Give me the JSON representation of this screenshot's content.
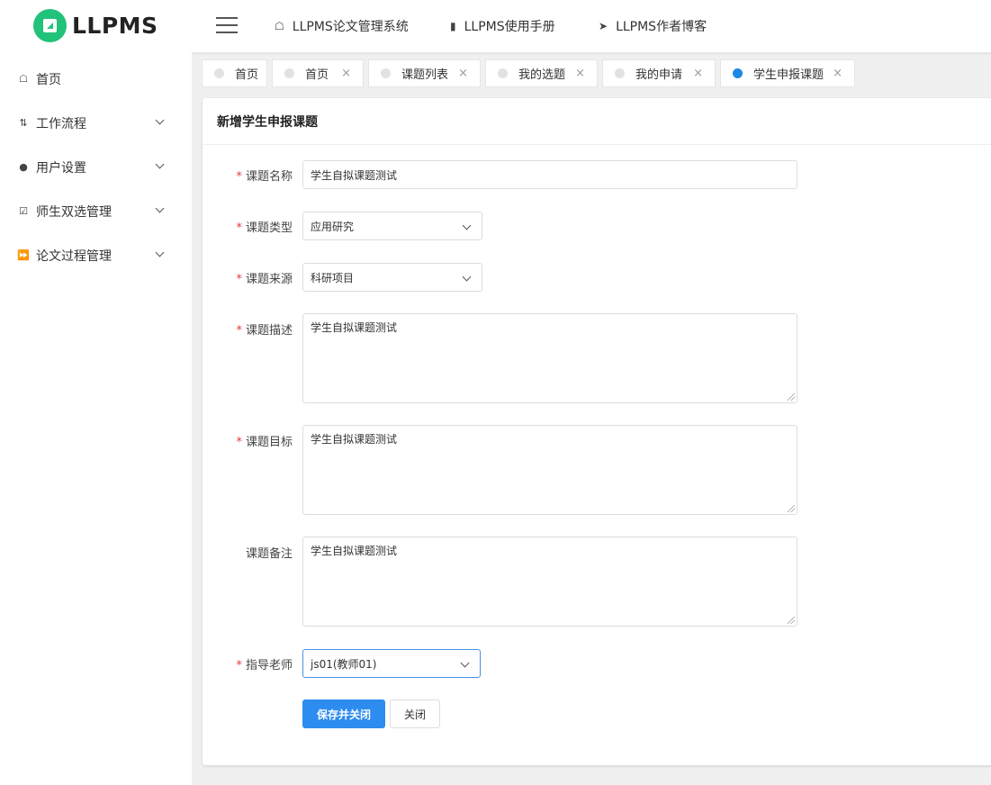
{
  "app": {
    "logo_text": "LLPMS"
  },
  "sidebar": {
    "items": [
      {
        "label": "首页",
        "icon": "home-icon"
      },
      {
        "label": "工作流程",
        "icon": "workflow-icon"
      },
      {
        "label": "用户设置",
        "icon": "user-icon"
      },
      {
        "label": "师生双选管理",
        "icon": "checkbox-icon"
      },
      {
        "label": "论文过程管理",
        "icon": "forward-icon"
      }
    ]
  },
  "header": {
    "nav": [
      {
        "label": "LLPMS论文管理系统",
        "icon": "home-icon"
      },
      {
        "label": "LLPMS使用手册",
        "icon": "document-icon"
      },
      {
        "label": "LLPMS作者博客",
        "icon": "send-icon"
      }
    ]
  },
  "tabs": [
    {
      "label": "首页",
      "closable": false,
      "active": false
    },
    {
      "label": "首页",
      "closable": true,
      "active": false
    },
    {
      "label": "课题列表",
      "closable": true,
      "active": false
    },
    {
      "label": "我的选题",
      "closable": true,
      "active": false
    },
    {
      "label": "我的申请",
      "closable": true,
      "active": false
    },
    {
      "label": "学生申报课题",
      "closable": true,
      "active": true
    }
  ],
  "form": {
    "title": "新增学生申报课题",
    "required_mark": "*",
    "topic_name": {
      "label": "课题名称",
      "value": "学生自拟课题测试"
    },
    "topic_type": {
      "label": "课题类型",
      "value": "应用研究"
    },
    "topic_source": {
      "label": "课题来源",
      "value": "科研项目"
    },
    "topic_desc": {
      "label": "课题描述",
      "value": "学生自拟课题测试"
    },
    "topic_goal": {
      "label": "课题目标",
      "value": "学生自拟课题测试"
    },
    "topic_note": {
      "label": "课题备注",
      "value": "学生自拟课题测试"
    },
    "advisor": {
      "label": "指导老师",
      "value": "js01(教师01)"
    },
    "save_label": "保存并关闭",
    "close_label": "关闭"
  },
  "colors": {
    "accent": "#2d8cf0",
    "brand": "#21c27a",
    "required": "#e03b3b"
  }
}
